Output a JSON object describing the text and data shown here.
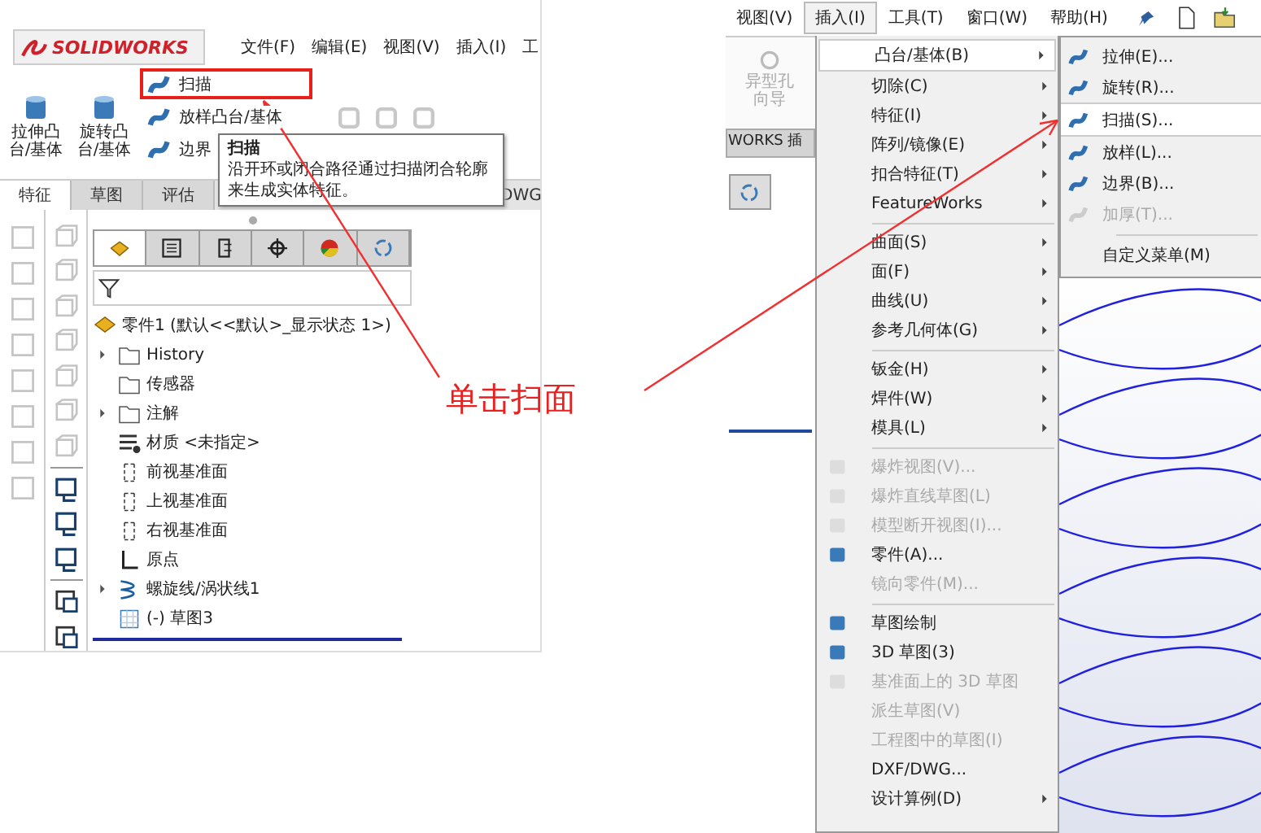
{
  "left": {
    "logo": "SOLIDWORKS",
    "menu": [
      "文件(F)",
      "编辑(E)",
      "视图(V)",
      "插入(I)",
      "工"
    ],
    "tools": [
      {
        "label": "拉伸凸台/基体"
      },
      {
        "label": "旋转凸台/基体"
      }
    ],
    "small_tools": [
      {
        "label": "扫描",
        "highlighted": true
      },
      {
        "label": "放样凸台/基体",
        "highlighted": false
      },
      {
        "label": "边界",
        "highlighted": false
      }
    ],
    "tabs": [
      {
        "label": "特征",
        "selected": true
      },
      {
        "label": "草图",
        "selected": false
      },
      {
        "label": "评估",
        "selected": false
      },
      {
        "label": "DWG",
        "selected": false
      }
    ],
    "tooltip": {
      "title": "扫描",
      "text": "沿开环或闭合路径通过扫描闭合轮廓来生成实体特征。"
    },
    "tree": {
      "root": "零件1 (默认<<默认>_显示状态 1>)",
      "items": [
        {
          "label": "History",
          "kind": "folder",
          "expandable": true
        },
        {
          "label": "传感器",
          "kind": "folder",
          "expandable": false
        },
        {
          "label": "注解",
          "kind": "folder",
          "expandable": true
        },
        {
          "label": "材质 <未指定>",
          "kind": "material",
          "expandable": false
        },
        {
          "label": "前视基准面",
          "kind": "plane",
          "expandable": false
        },
        {
          "label": "上视基准面",
          "kind": "plane",
          "expandable": false
        },
        {
          "label": "右视基准面",
          "kind": "plane",
          "expandable": false
        },
        {
          "label": "原点",
          "kind": "origin",
          "expandable": false
        },
        {
          "label": "螺旋线/涡状线1",
          "kind": "helix",
          "expandable": true
        },
        {
          "label": "(-) 草图3",
          "kind": "sketch",
          "expandable": false
        }
      ]
    }
  },
  "annotation": "单击扫面",
  "right": {
    "menu": [
      {
        "label": "视图(V)",
        "selected": false
      },
      {
        "label": "插入(I)",
        "selected": true
      },
      {
        "label": "工具(T)",
        "selected": false
      },
      {
        "label": "窗口(W)",
        "selected": false
      },
      {
        "label": "帮助(H)",
        "selected": false
      }
    ],
    "greyed_tool": "异型孔向导",
    "side_tab": "WORKS 插",
    "insert_menu": [
      {
        "kind": "item",
        "label": "凸台/基体(B)",
        "submenu": true,
        "disabled": false,
        "selected": true,
        "icon": false
      },
      {
        "kind": "item",
        "label": "切除(C)",
        "submenu": true,
        "disabled": false,
        "selected": false,
        "icon": false
      },
      {
        "kind": "item",
        "label": "特征(I)",
        "submenu": true,
        "disabled": false,
        "selected": false,
        "icon": false
      },
      {
        "kind": "item",
        "label": "阵列/镜像(E)",
        "submenu": true,
        "disabled": false,
        "selected": false,
        "icon": false
      },
      {
        "kind": "item",
        "label": "扣合特征(T)",
        "submenu": true,
        "disabled": false,
        "selected": false,
        "icon": false
      },
      {
        "kind": "item",
        "label": "FeatureWorks",
        "submenu": true,
        "disabled": false,
        "selected": false,
        "icon": false
      },
      {
        "kind": "separator"
      },
      {
        "kind": "item",
        "label": "曲面(S)",
        "submenu": true,
        "disabled": false,
        "selected": false,
        "icon": false
      },
      {
        "kind": "item",
        "label": "面(F)",
        "submenu": true,
        "disabled": false,
        "selected": false,
        "icon": false
      },
      {
        "kind": "item",
        "label": "曲线(U)",
        "submenu": true,
        "disabled": false,
        "selected": false,
        "icon": false
      },
      {
        "kind": "item",
        "label": "参考几何体(G)",
        "submenu": true,
        "disabled": false,
        "selected": false,
        "icon": false
      },
      {
        "kind": "separator"
      },
      {
        "kind": "item",
        "label": "钣金(H)",
        "submenu": true,
        "disabled": false,
        "selected": false,
        "icon": false
      },
      {
        "kind": "item",
        "label": "焊件(W)",
        "submenu": true,
        "disabled": false,
        "selected": false,
        "icon": false
      },
      {
        "kind": "item",
        "label": "模具(L)",
        "submenu": true,
        "disabled": false,
        "selected": false,
        "icon": false
      },
      {
        "kind": "separator"
      },
      {
        "kind": "item",
        "label": "爆炸视图(V)...",
        "submenu": false,
        "disabled": true,
        "selected": false,
        "icon": true
      },
      {
        "kind": "item",
        "label": "爆炸直线草图(L)",
        "submenu": false,
        "disabled": true,
        "selected": false,
        "icon": true
      },
      {
        "kind": "item",
        "label": "模型断开视图(I)...",
        "submenu": false,
        "disabled": true,
        "selected": false,
        "icon": true
      },
      {
        "kind": "item",
        "label": "零件(A)...",
        "submenu": false,
        "disabled": false,
        "selected": false,
        "icon": true
      },
      {
        "kind": "item",
        "label": "镜向零件(M)...",
        "submenu": false,
        "disabled": true,
        "selected": false,
        "icon": false
      },
      {
        "kind": "separator"
      },
      {
        "kind": "item",
        "label": "草图绘制",
        "submenu": false,
        "disabled": false,
        "selected": false,
        "icon": true
      },
      {
        "kind": "item",
        "label": "3D 草图(3)",
        "submenu": false,
        "disabled": false,
        "selected": false,
        "icon": true
      },
      {
        "kind": "item",
        "label": "基准面上的 3D 草图",
        "submenu": false,
        "disabled": true,
        "selected": false,
        "icon": true
      },
      {
        "kind": "item",
        "label": "派生草图(V)",
        "submenu": false,
        "disabled": true,
        "selected": false,
        "icon": false
      },
      {
        "kind": "item",
        "label": "工程图中的草图(I)",
        "submenu": false,
        "disabled": true,
        "selected": false,
        "icon": false
      },
      {
        "kind": "item",
        "label": "DXF/DWG...",
        "submenu": false,
        "disabled": false,
        "selected": false,
        "icon": false
      },
      {
        "kind": "item",
        "label": "设计算例(D)",
        "submenu": true,
        "disabled": false,
        "selected": false,
        "icon": false
      }
    ],
    "submenu": [
      {
        "kind": "item",
        "label": "拉伸(E)...",
        "disabled": false,
        "selected": false,
        "icon": true
      },
      {
        "kind": "item",
        "label": "旋转(R)...",
        "disabled": false,
        "selected": false,
        "icon": true
      },
      {
        "kind": "item",
        "label": "扫描(S)...",
        "disabled": false,
        "selected": true,
        "icon": true
      },
      {
        "kind": "item",
        "label": "放样(L)...",
        "disabled": false,
        "selected": false,
        "icon": true
      },
      {
        "kind": "item",
        "label": "边界(B)...",
        "disabled": false,
        "selected": false,
        "icon": true
      },
      {
        "kind": "item",
        "label": "加厚(T)...",
        "disabled": true,
        "selected": false,
        "icon": true
      },
      {
        "kind": "separator"
      },
      {
        "kind": "item",
        "label": "自定义菜单(M)",
        "disabled": false,
        "selected": false,
        "icon": false
      }
    ]
  }
}
